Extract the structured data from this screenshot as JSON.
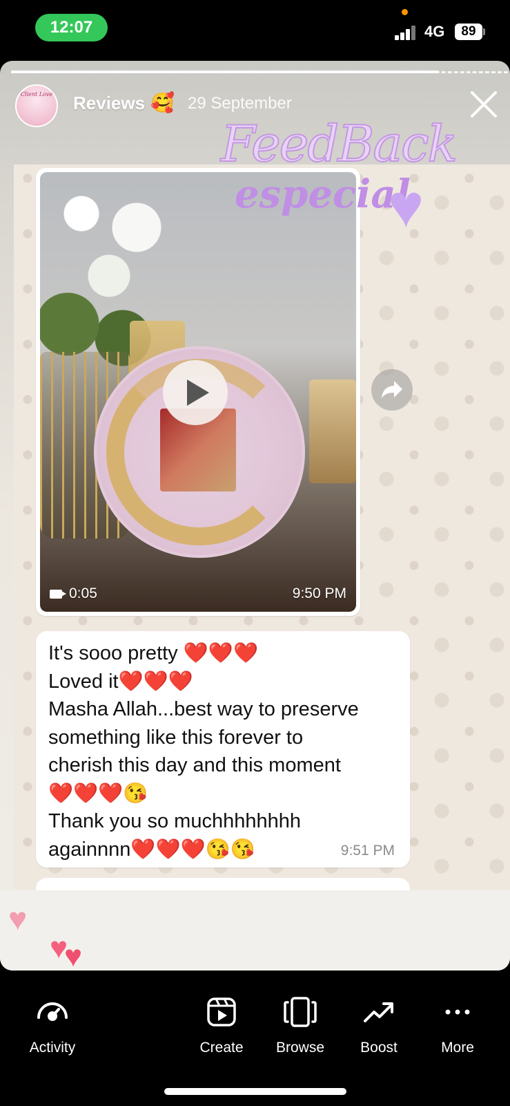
{
  "status_bar": {
    "time": "12:07",
    "network": "4G",
    "battery": "89",
    "time_pill_color": "#34c759"
  },
  "story": {
    "title": "Reviews",
    "title_emoji": "🥰",
    "date": "29 September",
    "avatar_text": "Client Love",
    "close_icon": "close-icon",
    "sticker": {
      "line1": "FeedBack",
      "line2": "especial"
    },
    "video": {
      "duration": "0:05",
      "time": "9:50 PM"
    },
    "message": {
      "lines": [
        "It's sooo pretty ❤️❤️❤️",
        "Loved it❤️❤️❤️",
        "Masha Allah...best way to preserve",
        "something like this forever to",
        "cherish this day and this moment",
        "❤️❤️❤️😘",
        "Thank you so muchhhhhhhh",
        "againnnn❤️❤️❤️😘😘"
      ],
      "time": "9:51 PM"
    }
  },
  "bottom_nav": {
    "items": [
      {
        "label": "Activity",
        "icon": "activity-icon"
      },
      {
        "label": "Create",
        "icon": "create-icon"
      },
      {
        "label": "Browse",
        "icon": "browse-icon"
      },
      {
        "label": "Boost",
        "icon": "boost-icon"
      },
      {
        "label": "More",
        "icon": "more-icon"
      }
    ]
  },
  "colors": {
    "heart_red": "#f2183a",
    "heart_pink": "#f4607e",
    "sticker_purple": "#c08ee5"
  }
}
